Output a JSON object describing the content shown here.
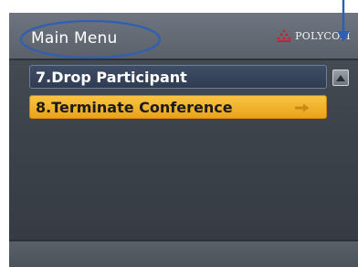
{
  "header": {
    "title": "Main Menu",
    "brand": "POLYCOM"
  },
  "menu": {
    "items": [
      {
        "label": "7.Drop Participant",
        "selected": false
      },
      {
        "label": "8.Terminate Conference",
        "selected": true
      }
    ]
  },
  "icons": {
    "brand": "polycom-logo-icon",
    "scroll": "scroll-up-arrow-icon",
    "item_indicator": "right-arrow-icon"
  },
  "colors": {
    "selection": "#f0b02d",
    "annotation": "#2f5fb0"
  }
}
